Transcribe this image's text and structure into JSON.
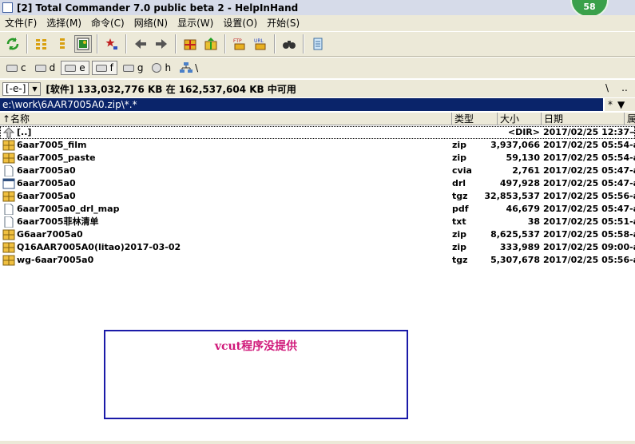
{
  "window": {
    "title": "[2] Total Commander 7.0 public beta 2 - HelpInHand",
    "badge": "58"
  },
  "menu": [
    "文件(F)",
    "选择(M)",
    "命令(C)",
    "网络(N)",
    "显示(W)",
    "设置(O)",
    "开始(S)"
  ],
  "drives": [
    {
      "letter": "c",
      "pressed": false
    },
    {
      "letter": "d",
      "pressed": false
    },
    {
      "letter": "e",
      "pressed": true
    },
    {
      "letter": "f",
      "pressed": true
    },
    {
      "letter": "g",
      "pressed": false
    },
    {
      "letter": "h",
      "pressed": false
    },
    {
      "letter": "\\",
      "pressed": false
    }
  ],
  "info": {
    "drive_value": "[-e-]",
    "free_space": "[软件]  133,032,776 KB 在 162,537,604 KB 中可用",
    "root_btn": "\\",
    "up_btn": ".."
  },
  "path": {
    "value": "e:\\work\\6AAR7005A0.zip\\*.*",
    "filter_btn": "*",
    "sort_btn": "▼"
  },
  "columns": {
    "name": "↑名称",
    "ext": "类型",
    "size": "大小",
    "date": "日期",
    "attr": "属"
  },
  "files": [
    {
      "icon": "up-folder",
      "name": "[..]",
      "ext": "",
      "size": "<DIR>",
      "date": "2017/02/25 12:37—"
    },
    {
      "icon": "archive",
      "name": "6aar7005_film",
      "ext": "zip",
      "size": "3,937,066",
      "date": "2017/02/25 05:54-a"
    },
    {
      "icon": "archive",
      "name": "6aar7005_paste",
      "ext": "zip",
      "size": "59,130",
      "date": "2017/02/25 05:54-a"
    },
    {
      "icon": "document",
      "name": "6aar7005a0",
      "ext": "cvia",
      "size": "2,761",
      "date": "2017/02/25 05:47-a"
    },
    {
      "icon": "window",
      "name": "6aar7005a0",
      "ext": "drl",
      "size": "497,928",
      "date": "2017/02/25 05:47-a"
    },
    {
      "icon": "archive",
      "name": "6aar7005a0",
      "ext": "tgz",
      "size": "32,853,537",
      "date": "2017/02/25 05:56-a"
    },
    {
      "icon": "document",
      "name": "6aar7005a0_drl_map",
      "ext": "pdf",
      "size": "46,679",
      "date": "2017/02/25 05:47-a"
    },
    {
      "icon": "document",
      "name": "6aar7005菲林清单",
      "ext": "txt",
      "size": "38",
      "date": "2017/02/25 05:51-a"
    },
    {
      "icon": "archive",
      "name": "G6aar7005a0",
      "ext": "zip",
      "size": "8,625,537",
      "date": "2017/02/25 05:58-a"
    },
    {
      "icon": "archive",
      "name": "Q16AAR7005A0(litao)2017-03-02",
      "ext": "zip",
      "size": "333,989",
      "date": "2017/02/25 09:00-a"
    },
    {
      "icon": "archive",
      "name": "wg-6aar7005a0",
      "ext": "tgz",
      "size": "5,307,678",
      "date": "2017/02/25 05:56-a"
    }
  ],
  "overlay": {
    "text": "vcut程序没提供",
    "border_color": "#1a1aa8",
    "text_color": "#d0197a"
  }
}
